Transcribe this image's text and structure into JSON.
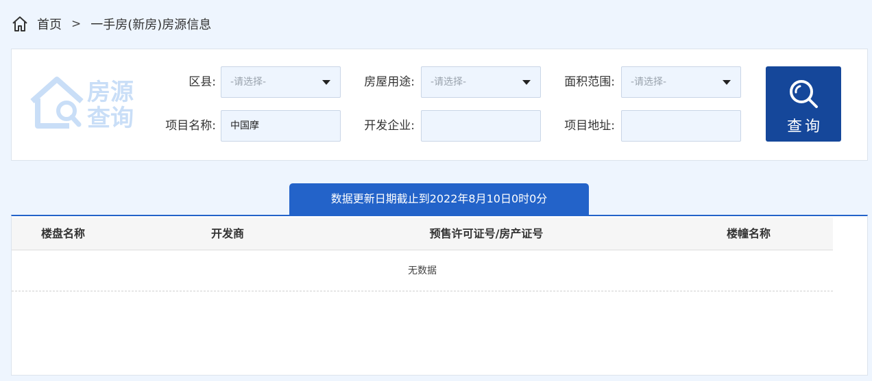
{
  "breadcrumb": {
    "home": "首页",
    "separator": ">",
    "current": "一手房(新房)房源信息"
  },
  "logo": {
    "line1": "房源",
    "line2": "查询"
  },
  "filters": {
    "district": {
      "label": "区县:",
      "value": "-请选择-"
    },
    "usage": {
      "label": "房屋用途:",
      "value": "-请选择-"
    },
    "area": {
      "label": "面积范围:",
      "value": "-请选择-"
    },
    "project_name": {
      "label": "项目名称:",
      "value": "中国摩"
    },
    "developer": {
      "label": "开发企业:",
      "value": ""
    },
    "address": {
      "label": "项目地址:",
      "value": ""
    }
  },
  "query_button": {
    "label": "查询"
  },
  "update_notice": "数据更新日期截止到2022年8月10日0时0分",
  "table": {
    "columns": [
      "楼盘名称",
      "开发商",
      "预售许可证号/房产证号",
      "楼幢名称"
    ],
    "empty_text": "无数据"
  },
  "colors": {
    "page_bg": "#eef5fe",
    "accent_dark": "#15479a",
    "accent": "#2363c9",
    "logo": "#c9def7"
  },
  "icons": {
    "home": "home-icon",
    "query": "search-icon",
    "logo": "house-search-icon"
  }
}
